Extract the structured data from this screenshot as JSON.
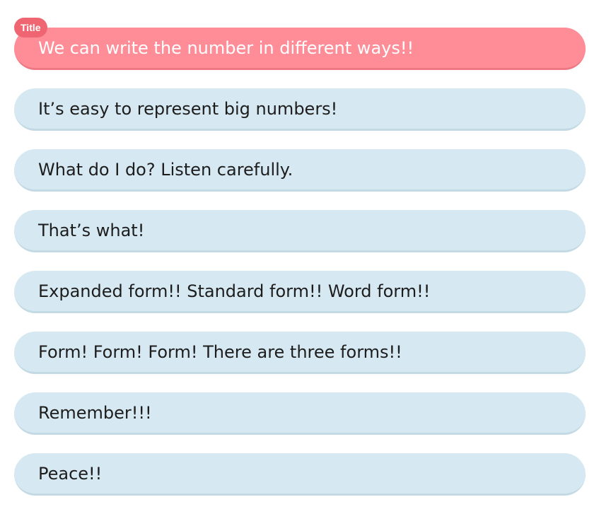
{
  "title_row": {
    "badge": "Title",
    "text": "We can write the number in different ways!!"
  },
  "lines": [
    "It’s easy to represent big numbers!",
    "What do I do? Listen carefully.",
    "That’s what!",
    "Expanded form!! Standard form!! Word form!!",
    "Form! Form! Form! There are three forms!!",
    "Remember!!!",
    "Peace!!"
  ],
  "colors": {
    "title_bg": "#ff8d98",
    "badge_bg": "#ef6672",
    "line_bg": "#d6e8f1"
  }
}
